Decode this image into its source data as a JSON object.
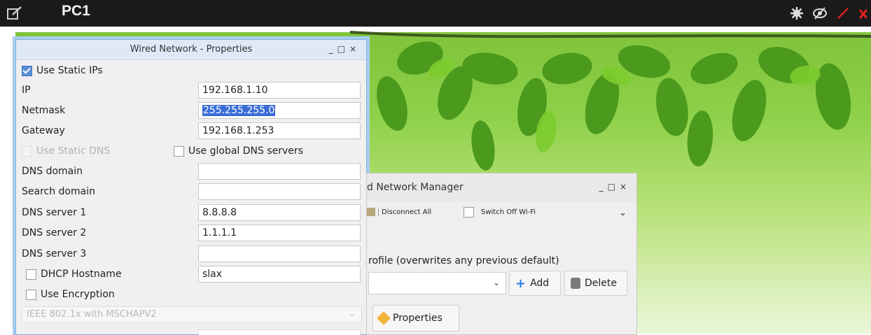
{
  "titlebar": {
    "title": "PC1"
  },
  "properties_dialog": {
    "title": "Wired Network - Properties",
    "use_static_ips": "Use Static IPs",
    "fields": [
      {
        "label": "IP",
        "value": "192.168.1.10"
      },
      {
        "label": "Netmask",
        "value": "255.255.255.0"
      },
      {
        "label": "Gateway",
        "value": "192.168.1.253"
      }
    ],
    "use_static_dns": "Use Static DNS",
    "use_global_dns": "Use global DNS servers",
    "dns_fields": [
      {
        "label": "DNS domain",
        "value": ""
      },
      {
        "label": "Search domain",
        "value": ""
      },
      {
        "label": "DNS server 1",
        "value": "8.8.8.8"
      },
      {
        "label": "DNS server 2",
        "value": "1.1.1.1"
      },
      {
        "label": "DNS server 3",
        "value": ""
      }
    ],
    "dhcp_hostname": {
      "label": "DHCP Hostname",
      "value": "slax"
    },
    "use_encryption": "Use Encryption",
    "encryption_method": "IEEE 802.1x with MSCHAPV2"
  },
  "network_manager": {
    "title": "d Network Manager",
    "disconnect_all": "Disconnect All",
    "switch_off_wifi": "Switch Off Wi-Fi",
    "profile_text": "rofile (overwrites any previous default)",
    "add_label": "Add",
    "delete_label": "Delete",
    "properties_label": "Properties"
  }
}
